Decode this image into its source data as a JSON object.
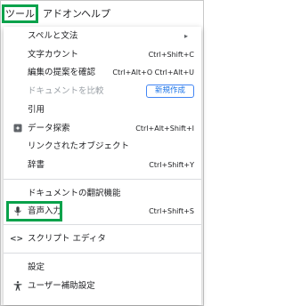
{
  "menubar": {
    "tools": "ツール",
    "addons": "アドオン",
    "help": "ヘルプ"
  },
  "menu": {
    "spelling": {
      "label": "スペルと文法"
    },
    "word_count": {
      "label": "文字カウント",
      "shortcut": "Ctrl+Shift+C"
    },
    "review_suggested": {
      "label": "編集の提案を確認",
      "shortcut": "Ctrl+Alt+O Ctrl+Alt+U"
    },
    "compare": {
      "label": "ドキュメントを比較",
      "badge": "新規作成"
    },
    "citations": {
      "label": "引用"
    },
    "explore": {
      "label": "データ探索",
      "shortcut": "Ctrl+Alt+Shift+I"
    },
    "linked_objects": {
      "label": "リンクされたオブジェクト"
    },
    "dictionary": {
      "label": "辞書",
      "shortcut": "Ctrl+Shift+Y"
    },
    "translate": {
      "label": "ドキュメントの翻訳機能"
    },
    "voice_typing": {
      "label": "音声入力",
      "shortcut": "Ctrl+Shift+S"
    },
    "script_editor": {
      "label": "スクリプト エディタ"
    },
    "preferences": {
      "label": "設定"
    },
    "accessibility": {
      "label": "ユーザー補助設定"
    }
  },
  "colors": {
    "highlight": "#0aa24b",
    "badge": "#1a73e8",
    "disabled_text": "#9aa0a6"
  },
  "icons": {
    "explore": "explore-icon",
    "voice_typing": "microphone-icon",
    "script_editor": "code-icon",
    "accessibility": "accessibility-icon",
    "submenu": "submenu-arrow-icon"
  }
}
